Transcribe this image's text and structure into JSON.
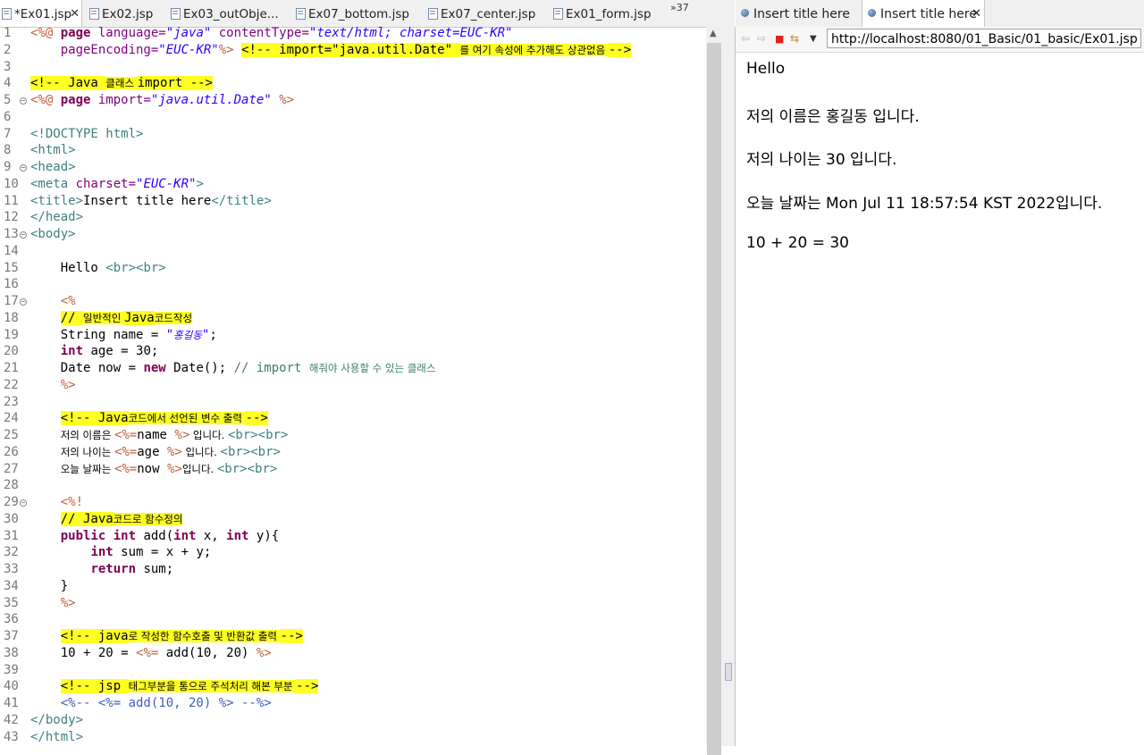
{
  "editor": {
    "tabs": [
      {
        "label": "*Ex01.jsp",
        "active": true
      },
      {
        "label": "Ex02.jsp",
        "active": false
      },
      {
        "label": "Ex03_outObje...",
        "active": false
      },
      {
        "label": "Ex07_bottom.jsp",
        "active": false
      },
      {
        "label": "Ex07_center.jsp",
        "active": false
      },
      {
        "label": "Ex01_form.jsp",
        "active": false
      }
    ],
    "overflow_label": "»37",
    "line_numbers": [
      "1",
      "2",
      "3",
      "4",
      "5",
      "6",
      "7",
      "8",
      "9",
      "10",
      "11",
      "12",
      "13",
      "14",
      "15",
      "16",
      "17",
      "18",
      "19",
      "20",
      "21",
      "22",
      "23",
      "24",
      "25",
      "26",
      "27",
      "28",
      "29",
      "30",
      "31",
      "32",
      "33",
      "34",
      "35",
      "36",
      "37",
      "38",
      "39",
      "40",
      "41",
      "42",
      "43"
    ],
    "lines": [
      [
        [
          "jp",
          "<%@ "
        ],
        [
          "k",
          "page "
        ],
        [
          "at",
          "language="
        ],
        [
          "st",
          "\"java\" "
        ],
        [
          "at",
          "contentType="
        ],
        [
          "st",
          "\"text/html; charset=EUC-KR\""
        ]
      ],
      [
        [
          "",
          "    "
        ],
        [
          "at",
          "pageEncoding="
        ],
        [
          "st",
          "\"EUC-KR\""
        ],
        [
          "jp",
          "%> "
        ],
        [
          "hl",
          "<!-- import=\"java.util.Date\" "
        ],
        [
          "hlko",
          "를 여기 속성에 추가해도 상관없음 "
        ],
        [
          "hl",
          "-->"
        ]
      ],
      [],
      [
        [
          "hl",
          "<!-- Java "
        ],
        [
          "hlko",
          "클래스 "
        ],
        [
          "hl",
          "import -->"
        ]
      ],
      [
        [
          "jp",
          "<%@ "
        ],
        [
          "k",
          "page "
        ],
        [
          "at",
          "import="
        ],
        [
          "st",
          "\"java.util.Date\" "
        ],
        [
          "jp",
          "%>"
        ]
      ],
      [],
      [
        [
          "tg",
          "<!DOCTYPE html>"
        ]
      ],
      [
        [
          "tg",
          "<html>"
        ]
      ],
      [
        [
          "tg",
          "<head>"
        ]
      ],
      [
        [
          "tg",
          "<meta "
        ],
        [
          "at",
          "charset="
        ],
        [
          "st",
          "\"EUC-KR\""
        ],
        [
          "tg",
          ">"
        ]
      ],
      [
        [
          "tg",
          "<title>"
        ],
        [
          "",
          "Insert title here"
        ],
        [
          "tg",
          "</title>"
        ]
      ],
      [
        [
          "tg",
          "</head>"
        ]
      ],
      [
        [
          "tg",
          "<body>"
        ]
      ],
      [],
      [
        [
          "",
          "    Hello "
        ],
        [
          "tg",
          "<br><br>"
        ]
      ],
      [],
      [
        [
          "",
          "    "
        ],
        [
          "jp",
          "<%"
        ]
      ],
      [
        [
          "",
          "    "
        ],
        [
          "hl",
          "// "
        ],
        [
          "hlko",
          "일반적인 "
        ],
        [
          "hl",
          "Java"
        ],
        [
          "hlko",
          "코드작성"
        ]
      ],
      [
        [
          "",
          "    String name = "
        ],
        [
          "st2",
          "\""
        ],
        [
          "ko2",
          "홍길동"
        ],
        [
          "st2",
          "\""
        ],
        [
          "",
          ";"
        ]
      ],
      [
        [
          "",
          "    "
        ],
        [
          "k",
          "int "
        ],
        [
          "",
          "age = 30;"
        ]
      ],
      [
        [
          "",
          "    Date now = "
        ],
        [
          "k",
          "new "
        ],
        [
          "",
          "Date(); "
        ],
        [
          "cm",
          "// import "
        ],
        [
          "cmko",
          "해줘야 사용할 수 있는 클래스"
        ]
      ],
      [
        [
          "",
          "    "
        ],
        [
          "jp",
          "%>"
        ]
      ],
      [],
      [
        [
          "",
          "    "
        ],
        [
          "hl",
          "<!-- Java"
        ],
        [
          "hlko",
          "코드에서 선언된 변수 출력 "
        ],
        [
          "hl",
          "-->"
        ]
      ],
      [
        [
          "",
          "    "
        ],
        [
          "ko",
          "저의 이름은 "
        ],
        [
          "jp",
          "<%="
        ],
        [
          "",
          "name "
        ],
        [
          "jp",
          "%>"
        ],
        [
          "ko",
          " 입니다. "
        ],
        [
          "tg",
          "<br><br>"
        ]
      ],
      [
        [
          "",
          "    "
        ],
        [
          "ko",
          "저의 나이는 "
        ],
        [
          "jp",
          "<%="
        ],
        [
          "",
          "age "
        ],
        [
          "jp",
          "%>"
        ],
        [
          "ko",
          " 입니다. "
        ],
        [
          "tg",
          "<br><br>"
        ]
      ],
      [
        [
          "",
          "    "
        ],
        [
          "ko",
          "오늘 날짜는 "
        ],
        [
          "jp",
          "<%="
        ],
        [
          "",
          "now "
        ],
        [
          "jp",
          "%>"
        ],
        [
          "ko",
          "입니다. "
        ],
        [
          "tg",
          "<br><br>"
        ]
      ],
      [],
      [
        [
          "",
          "    "
        ],
        [
          "jp",
          "<%!"
        ]
      ],
      [
        [
          "",
          "    "
        ],
        [
          "hl",
          "// Java"
        ],
        [
          "hlko",
          "코드로 함수정의"
        ]
      ],
      [
        [
          "",
          "    "
        ],
        [
          "k",
          "public int "
        ],
        [
          "",
          "add("
        ],
        [
          "k",
          "int "
        ],
        [
          "",
          "x, "
        ],
        [
          "k",
          "int "
        ],
        [
          "",
          "y){"
        ]
      ],
      [
        [
          "",
          "        "
        ],
        [
          "k",
          "int "
        ],
        [
          "",
          "sum = x + y;"
        ]
      ],
      [
        [
          "",
          "        "
        ],
        [
          "k",
          "return "
        ],
        [
          "",
          "sum;"
        ]
      ],
      [
        [
          "",
          "    }"
        ]
      ],
      [
        [
          "",
          "    "
        ],
        [
          "jp",
          "%>"
        ]
      ],
      [],
      [
        [
          "",
          "    "
        ],
        [
          "hl",
          "<!-- java"
        ],
        [
          "hlko",
          "로 작성한 함수호출 및 반환값 출력 "
        ],
        [
          "hl",
          "-->"
        ]
      ],
      [
        [
          "",
          "    10 + 20 = "
        ],
        [
          "jp",
          "<%="
        ],
        [
          "",
          "",
          " "
        ],
        [
          "",
          "add(10, 20) "
        ],
        [
          "jp",
          "%>"
        ]
      ],
      [],
      [
        [
          "",
          "    "
        ],
        [
          "hl",
          "<!-- jsp "
        ],
        [
          "hlko",
          "태그부분을 통으로 주석처리 해본 부분 "
        ],
        [
          "hl",
          "-->"
        ]
      ],
      [
        [
          "",
          "    "
        ],
        [
          "cmj",
          "<%-- <%= add(10, 20) %> --%>"
        ]
      ],
      [
        [
          "tg",
          "</body>"
        ]
      ],
      [
        [
          "tg",
          "</html>"
        ]
      ]
    ]
  },
  "browser": {
    "tabs": [
      {
        "label": "Insert title here",
        "active": false
      },
      {
        "label": "Insert title here",
        "active": true
      }
    ],
    "url": "http://localhost:8080/01_Basic/01_basic/Ex01.jsp",
    "output": [
      "Hello",
      "저의 이름은 홍길동 입니다.",
      "저의 나이는 30 입니다.",
      "오늘 날짜는 Mon Jul 11 18:57:54 KST 2022입니다.",
      "10 + 20 = 30"
    ]
  }
}
